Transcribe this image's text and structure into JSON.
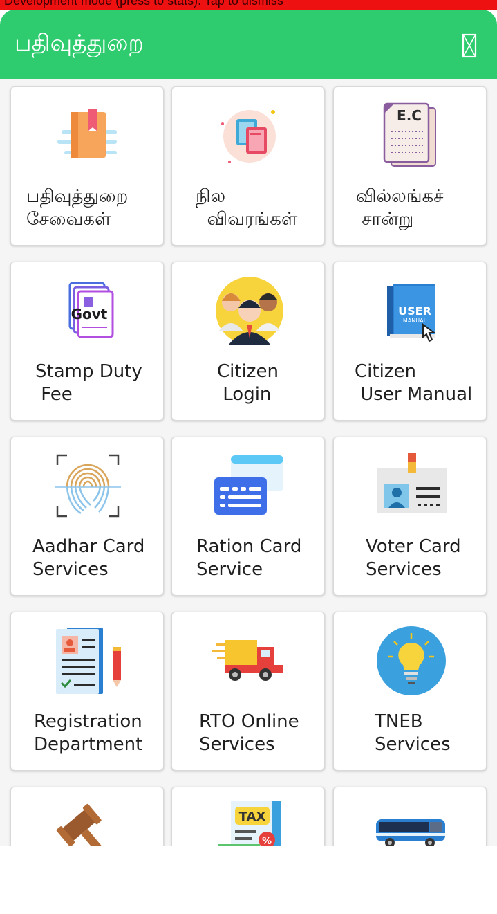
{
  "banner": {
    "text": "Development mode (press to stats). Tap to dismiss"
  },
  "app_bar": {
    "title": "பதிவுத்துறை",
    "close_icon": "close-icon"
  },
  "colors": {
    "app_bar": "#2ecc6e",
    "banner": "#ee1111",
    "card_border": "#d9d9d9"
  },
  "cards": [
    {
      "label": "பதிவுத்துறை\nசேவைகள்",
      "icon": "book-icon"
    },
    {
      "label": "நில\n  விவரங்கள்",
      "icon": "land-records-icon"
    },
    {
      "label": "வில்லங்கச்\n சான்று",
      "icon": "ec-document-icon"
    },
    {
      "label": "Stamp Duty\n Fee",
      "icon": "govt-document-icon"
    },
    {
      "label": "Citizen\n Login",
      "icon": "citizen-group-icon"
    },
    {
      "label": "Citizen\n User Manual",
      "icon": "user-manual-icon"
    },
    {
      "label": "Aadhar Card\nServices",
      "icon": "fingerprint-icon"
    },
    {
      "label": "Ration Card\nService",
      "icon": "ration-card-icon"
    },
    {
      "label": "Voter Card\nServices",
      "icon": "voter-id-icon"
    },
    {
      "label": "Registration\nDepartment",
      "icon": "registration-form-icon"
    },
    {
      "label": "RTO Online\nServices",
      "icon": "delivery-truck-icon"
    },
    {
      "label": "TNEB\nServices",
      "icon": "light-bulb-icon"
    },
    {
      "label": "",
      "icon": "gavel-icon"
    },
    {
      "label": "",
      "icon": "tax-document-icon"
    },
    {
      "label": "",
      "icon": "bus-icon"
    }
  ]
}
